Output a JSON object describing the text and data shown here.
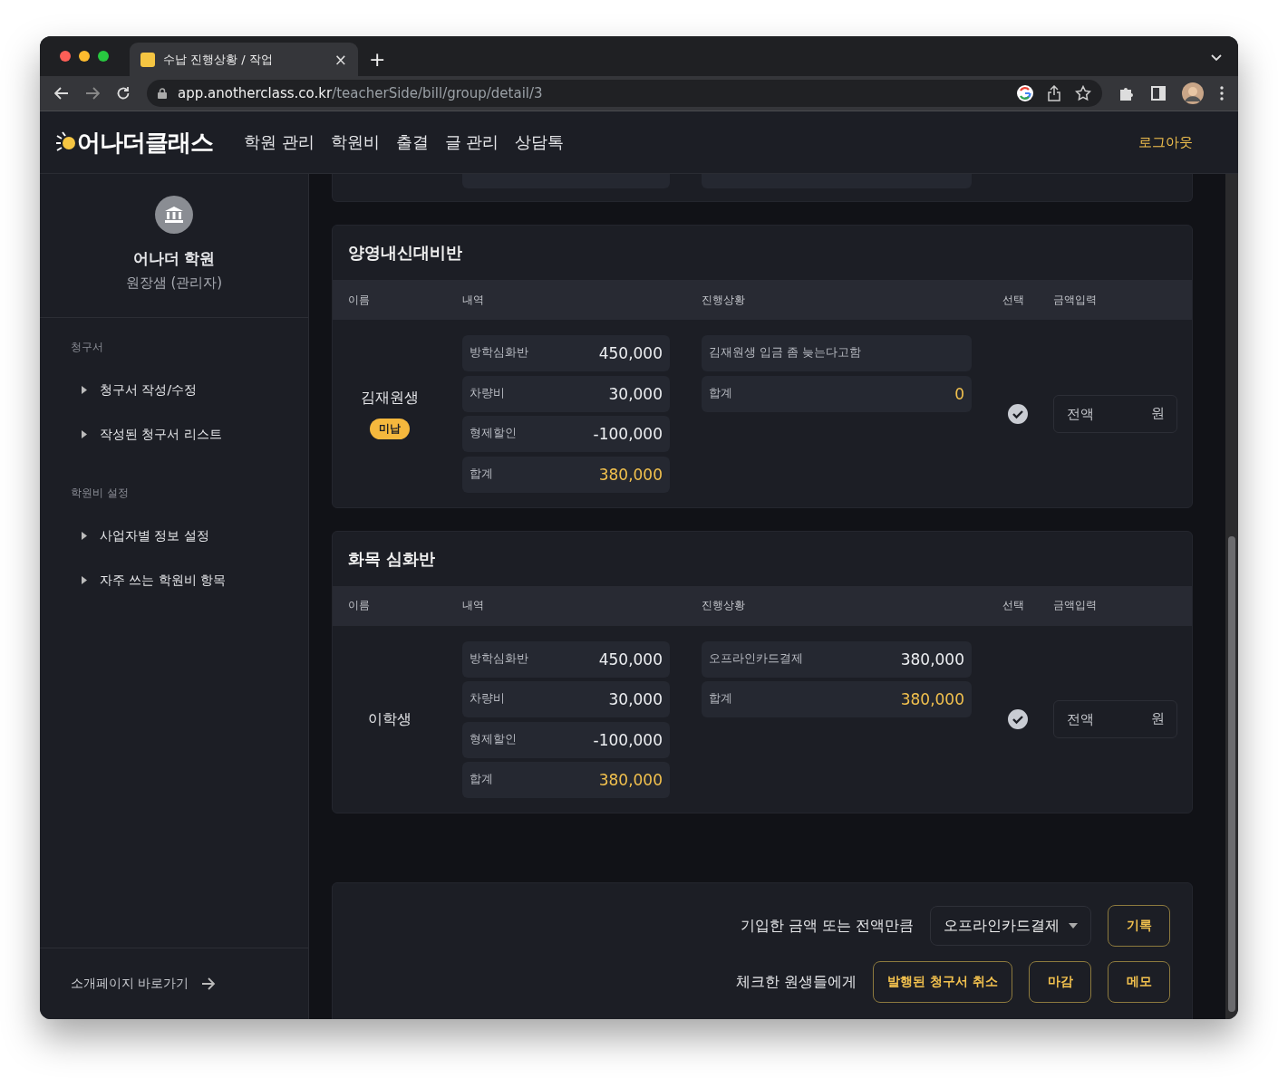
{
  "browser": {
    "tab": {
      "title": "수납 진행상황 / 작업",
      "close": "×"
    },
    "new_tab": "+",
    "url": {
      "host": "app.anotherclass.co.kr",
      "path": "/teacherSide/bill/group/detail/3"
    }
  },
  "header": {
    "logo": "어나더클래스",
    "nav": [
      "학원 관리",
      "학원비",
      "출결",
      "글 관리",
      "상담톡"
    ],
    "logout": "로그아웃"
  },
  "sidebar": {
    "academy": "어나더 학원",
    "role": "원장샘 (관리자)",
    "sections": [
      {
        "title": "청구서",
        "items": [
          "청구서 작성/수정",
          "작성된 청구서 리스트"
        ]
      },
      {
        "title": "학원비 설정",
        "items": [
          "사업자별 정보 설정",
          "자주 쓰는 학원비 항목"
        ]
      }
    ],
    "footer_link": "소개페이지 바로가기"
  },
  "groups": [
    {
      "title": "양영내신대비반",
      "columns": [
        "이름",
        "내역",
        "진행상황",
        "선택",
        "금액입력"
      ],
      "rows": [
        {
          "name": "김재원생",
          "badge": "미납",
          "checked": true,
          "amount_input": {
            "placeholder": "전액",
            "unit": "원"
          },
          "items": [
            {
              "kind": "entry",
              "label": "방학심화반",
              "amount": "450,000"
            },
            {
              "kind": "entry",
              "label": "차량비",
              "amount": "30,000"
            },
            {
              "kind": "entry",
              "label": "형제할인",
              "amount": "-100,000"
            },
            {
              "kind": "total",
              "label": "합계",
              "amount": "380,000"
            }
          ],
          "progress": [
            {
              "kind": "note",
              "label": "김재원생 입금 좀 늦는다고함"
            },
            {
              "kind": "total",
              "label": "합계",
              "amount": "0"
            }
          ]
        }
      ]
    },
    {
      "title": "화목 심화반",
      "columns": [
        "이름",
        "내역",
        "진행상황",
        "선택",
        "금액입력"
      ],
      "rows": [
        {
          "name": "이학생",
          "checked": true,
          "amount_input": {
            "placeholder": "전액",
            "unit": "원"
          },
          "items": [
            {
              "kind": "entry",
              "label": "방학심화반",
              "amount": "450,000"
            },
            {
              "kind": "entry",
              "label": "차량비",
              "amount": "30,000"
            },
            {
              "kind": "entry",
              "label": "형제할인",
              "amount": "-100,000"
            },
            {
              "kind": "total",
              "label": "합계",
              "amount": "380,000"
            }
          ],
          "progress": [
            {
              "kind": "entry",
              "label": "오프라인카드결제",
              "amount": "380,000"
            },
            {
              "kind": "total",
              "label": "합계",
              "amount": "380,000"
            }
          ]
        }
      ]
    }
  ],
  "actions": {
    "record_label": "기입한 금액 또는 전액만큼",
    "payment_method": "오프라인카드결제",
    "record_button": "기록",
    "checked_label": "체크한 원생들에게",
    "buttons": [
      "발행된 청구서 취소",
      "마감",
      "메모"
    ]
  }
}
